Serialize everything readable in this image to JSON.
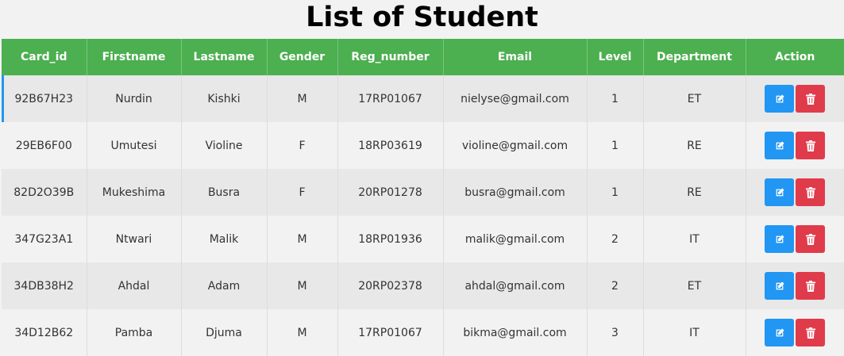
{
  "page": {
    "title": "List of Student"
  },
  "table": {
    "headers": [
      "Card_id",
      "Firstname",
      "Lastname",
      "Gender",
      "Reg_number",
      "Email",
      "Level",
      "Department",
      "Action"
    ],
    "rows": [
      [
        "92B67H23",
        "Nurdin",
        "Kishki",
        "M",
        "17RP01067",
        "nielyse@gmail.com",
        "1",
        "ET"
      ],
      [
        "29EB6F00",
        "Umutesi",
        "Violine",
        "F",
        "18RP03619",
        "violine@gmail.com",
        "1",
        "RE"
      ],
      [
        "82D2O39B",
        "Mukeshima",
        "Busra",
        "F",
        "20RP01278",
        "busra@gmail.com",
        "1",
        "RE"
      ],
      [
        "347G23A1",
        "Ntwari",
        "Malik",
        "M",
        "18RP01936",
        "malik@gmail.com",
        "2",
        "IT"
      ],
      [
        "34DB38H2",
        "Ahdal",
        "Adam",
        "M",
        "20RP02378",
        "ahdal@gmail.com",
        "2",
        "ET"
      ],
      [
        "34D12B62",
        "Pamba",
        "Djuma",
        "M",
        "17RP01067",
        "bikma@gmail.com",
        "3",
        "IT"
      ]
    ]
  },
  "actions": {
    "edit_icon": "edit-icon",
    "delete_icon": "trash-icon"
  },
  "colors": {
    "header": "#4caf50",
    "edit": "#2196f3",
    "delete": "#e03b4b"
  }
}
